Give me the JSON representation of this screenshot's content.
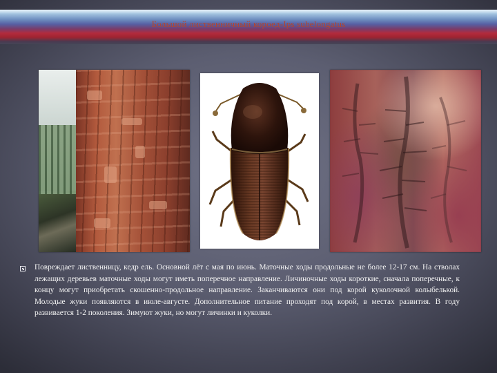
{
  "slide": {
    "title": "Большой лиственничный короед-Ips subelongatus",
    "body": "Повреждает лиственницу, кедр ель. Основной лёт с мая по июнь. Маточные ходы продольные не более 12-17 см. На стволах лежащих деревьев маточные ходы могут иметь поперечное направление. Личиночные ходы короткие, сначала поперечные, к концу могут приобретать скошенно-продольное направление. Заканчиваются они под корой куколочной колыбелькой. Молодые жуки появляются в июле-августе. Дополнительное питание проходят под корой, в местах развития. В году развивается 1-2 поколения. Зимуют жуки, но могут личинки и куколки."
  },
  "colors": {
    "title_text": "#b4462f",
    "body_text": "#f2f2f2",
    "background": "#5c5e71"
  },
  "icons": {
    "bullet": "square-bullet-icon"
  }
}
